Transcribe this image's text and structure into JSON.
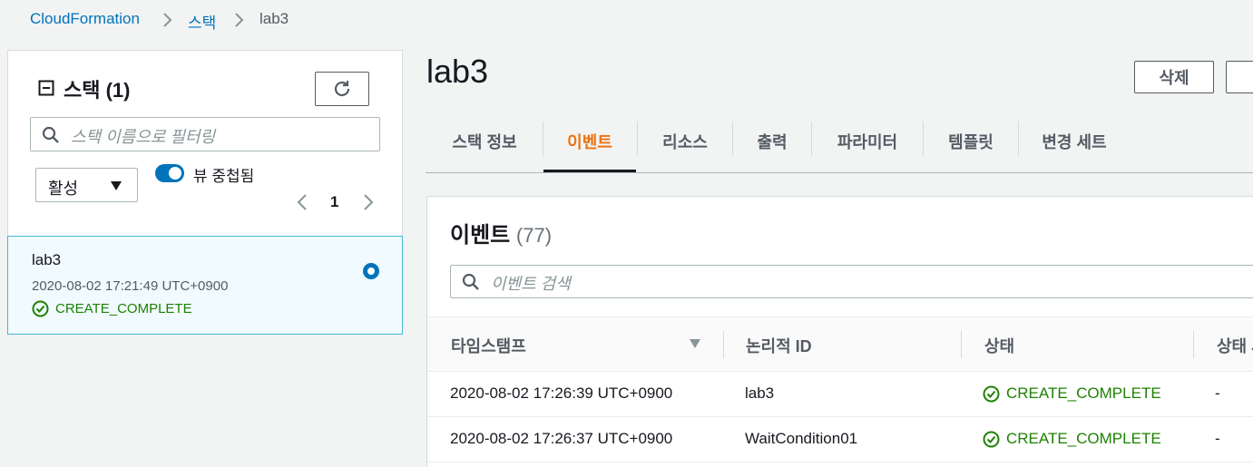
{
  "breadcrumb": [
    "CloudFormation",
    "스택",
    "lab3"
  ],
  "stacks_panel": {
    "title": "스택",
    "count": "(1)",
    "search_placeholder": "스택 이름으로 필터링",
    "filter_value": "활성",
    "toggle_label": "뷰 중첩됨",
    "toggle_on": true,
    "page": "1",
    "items": [
      {
        "name": "lab3",
        "time": "2020-08-02 17:21:49 UTC+0900",
        "status": "CREATE_COMPLETE",
        "selected": true
      }
    ]
  },
  "stack_detail": {
    "title": "lab3",
    "delete_button": "삭제",
    "tabs": [
      {
        "label": "스택 정보",
        "active": false
      },
      {
        "label": "이벤트",
        "active": true
      },
      {
        "label": "리소스",
        "active": false
      },
      {
        "label": "출력",
        "active": false
      },
      {
        "label": "파라미터",
        "active": false
      },
      {
        "label": "템플릿",
        "active": false
      },
      {
        "label": "변경 세트",
        "active": false
      }
    ]
  },
  "events": {
    "title": "이벤트",
    "count": "(77)",
    "search_placeholder": "이벤트 검색",
    "columns": [
      "타임스탬프",
      "논리적 ID",
      "상태",
      "상태 사유"
    ],
    "rows": [
      {
        "timestamp": "2020-08-02 17:26:39 UTC+0900",
        "logical_id": "lab3",
        "status": "CREATE_COMPLETE",
        "reason": "-"
      },
      {
        "timestamp": "2020-08-02 17:26:37 UTC+0900",
        "logical_id": "WaitCondition01",
        "status": "CREATE_COMPLETE",
        "reason": "-"
      }
    ]
  },
  "colors": {
    "link": "#0073bb",
    "success": "#1d8102",
    "active_tab": "#ec7211",
    "selected_bg": "#f1faff",
    "selected_border": "#44b9d6"
  },
  "icons": [
    "chevron-right-icon",
    "collapse-icon",
    "refresh-icon",
    "search-icon",
    "caret-down-icon",
    "chevron-left-icon",
    "check-circle-icon",
    "sort-desc-icon"
  ]
}
